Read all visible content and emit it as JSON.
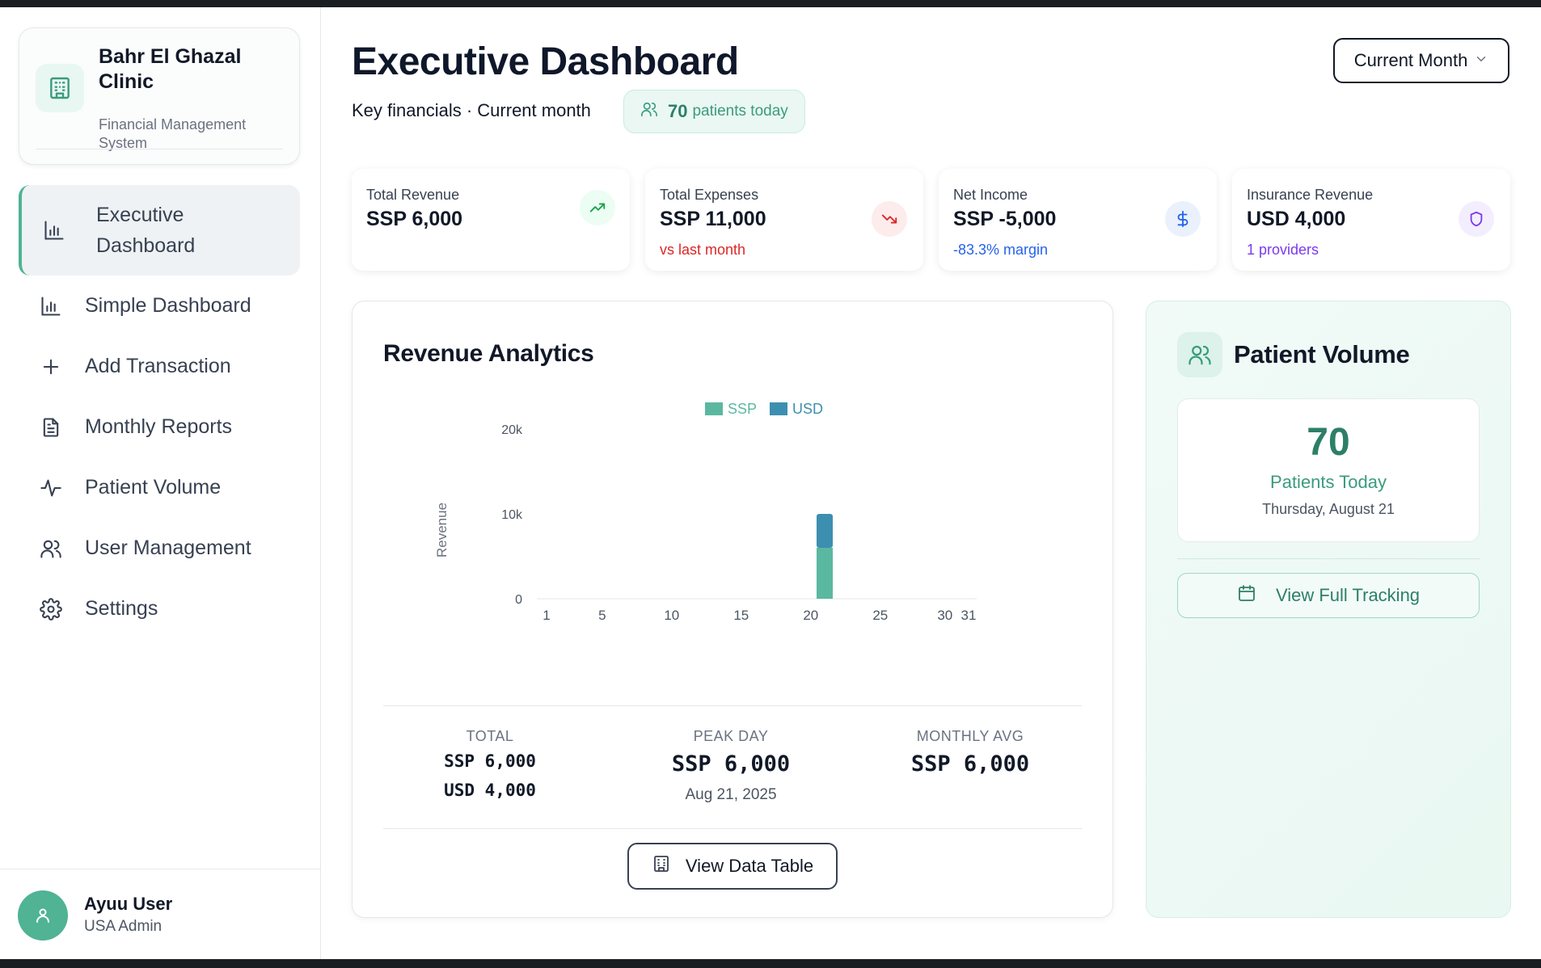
{
  "sidebar": {
    "brand_name": "Bahr El Ghazal Clinic",
    "brand_subtitle": "Financial Management System",
    "nav": [
      {
        "label": "Executive Dashboard",
        "icon": "bar-chart-icon",
        "active": true
      },
      {
        "label": "Simple Dashboard",
        "icon": "bar-chart-icon"
      },
      {
        "label": "Add Transaction",
        "icon": "plus-icon"
      },
      {
        "label": "Monthly Reports",
        "icon": "document-icon"
      },
      {
        "label": "Patient Volume",
        "icon": "activity-icon"
      },
      {
        "label": "User Management",
        "icon": "users-icon"
      },
      {
        "label": "Settings",
        "icon": "gear-icon"
      }
    ],
    "user": {
      "name": "Ayuu User",
      "role": "USA Admin"
    }
  },
  "header": {
    "title": "Executive Dashboard",
    "subtitle": "Key financials · Current month",
    "patients_count": "70",
    "patients_label": "patients today",
    "period_select": "Current Month"
  },
  "kpis": [
    {
      "label": "Total Revenue",
      "value": "SSP 6,000",
      "note": "",
      "icon": "trending-up-icon",
      "color": "#16a34a"
    },
    {
      "label": "Total Expenses",
      "value": "SSP 11,000",
      "note": "vs last month",
      "icon": "trending-down-icon",
      "color": "#dc2626"
    },
    {
      "label": "Net Income",
      "value": "SSP -5,000",
      "note": "-83.3% margin",
      "icon": "dollar-icon",
      "color": "#2563eb"
    },
    {
      "label": "Insurance Revenue",
      "value": "USD 4,000",
      "note": "1 providers",
      "icon": "shield-icon",
      "color": "#7c3aed"
    }
  ],
  "revenue": {
    "title": "Revenue Analytics",
    "stats": {
      "total_label": "TOTAL",
      "total_ssp": "SSP 6,000",
      "total_usd": "USD 4,000",
      "peak_label": "PEAK DAY",
      "peak_value": "SSP 6,000",
      "peak_date": "Aug 21, 2025",
      "avg_label": "MONTHLY AVG",
      "avg_value": "SSP 6,000"
    },
    "data_table_button": "View Data Table"
  },
  "chart_data": {
    "type": "bar",
    "stacked": true,
    "ylabel": "Revenue",
    "xlabel": "",
    "ylim": [
      0,
      20000
    ],
    "y_ticks": [
      "0",
      "10k",
      "20k"
    ],
    "x_ticks": [
      "1",
      "5",
      "10",
      "15",
      "20",
      "25",
      "30",
      "31"
    ],
    "x_range": [
      1,
      31
    ],
    "legend": "top-center",
    "series": [
      {
        "name": "SSP",
        "color": "#5bb8a0",
        "points": [
          {
            "x": 21,
            "y": 6000
          }
        ]
      },
      {
        "name": "USD",
        "color": "#3d8fb0",
        "points": [
          {
            "x": 21,
            "y": 4000
          }
        ]
      }
    ]
  },
  "patient_volume": {
    "title": "Patient Volume",
    "count": "70",
    "label": "Patients Today",
    "date": "Thursday, August 21",
    "button": "View Full Tracking"
  }
}
